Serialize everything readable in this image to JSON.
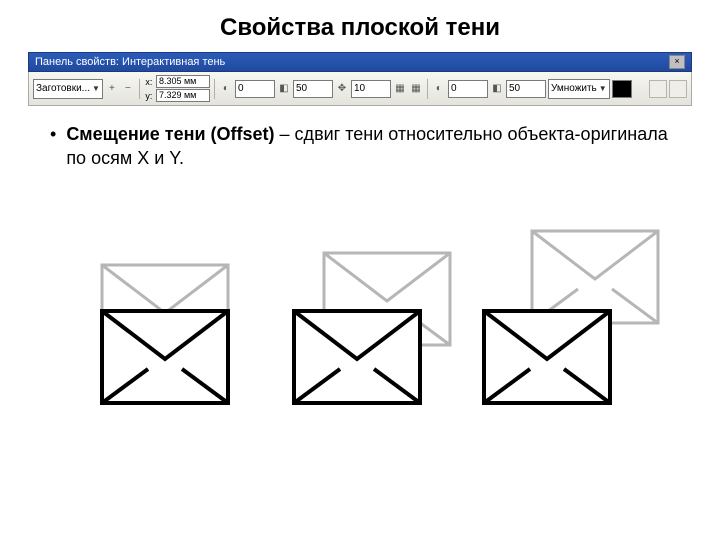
{
  "title": "Свойства плоской тени",
  "toolbar": {
    "titlebar": "Панель свойств: Интерактивная тень",
    "close": "×",
    "preset": "Заготовки...",
    "x_label": "x:",
    "y_label": "y:",
    "x_value": "8.305 мм",
    "y_value": "7.329 мм",
    "opacity_a": "0",
    "opacity_b": "50",
    "feather": "10",
    "val_d": "0",
    "val_e": "50",
    "blend_mode": "Умножить"
  },
  "body": {
    "bullet": "•",
    "bold": "Смещение тени (Offset)",
    "rest": " – сдвиг тени относительно объекта-оригинала по осям X и Y."
  }
}
